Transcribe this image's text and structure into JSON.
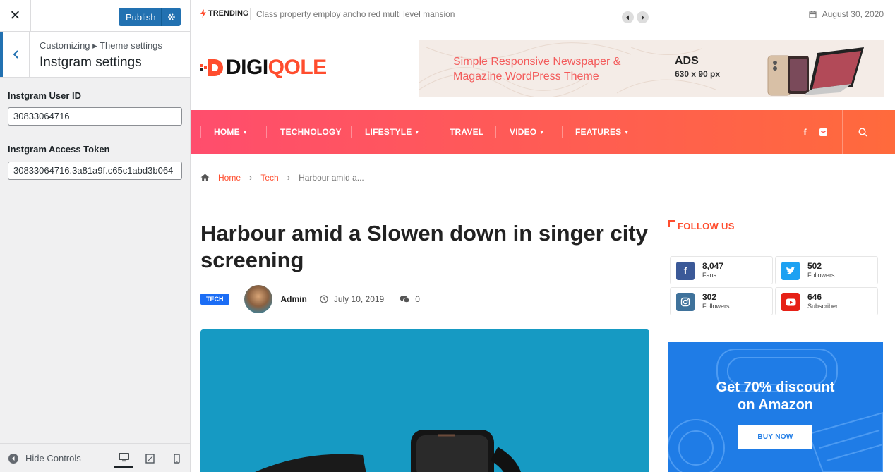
{
  "sidebar": {
    "publish_label": "Publish",
    "breadcrumb": "Customizing ▸ Theme settings",
    "section_title": "Instgram settings",
    "fields": [
      {
        "label": "Instgram User ID",
        "value": "30833064716"
      },
      {
        "label": "Instgram Access Token",
        "value": "30833064716.3a81a9f.c65c1abd3b064"
      }
    ],
    "hide_controls_label": "Hide Controls"
  },
  "site": {
    "trending_label": "TRENDING",
    "trending_headline": "Class property employ ancho red multi level mansion",
    "date": "August 30, 2020",
    "logo_prefix": "DIGI",
    "logo_suffix": "QOLE",
    "ad": {
      "tagline_1": "Simple Responsive Newspaper &",
      "tagline_2": "Magazine WordPress Theme",
      "title": "ADS",
      "size": "630 x 90 px"
    },
    "nav": [
      {
        "label": "HOME",
        "dropdown": true
      },
      {
        "label": "TECHNOLOGY",
        "dropdown": false
      },
      {
        "label": "LIFESTYLE",
        "dropdown": true
      },
      {
        "label": "TRAVEL",
        "dropdown": false
      },
      {
        "label": "VIDEO",
        "dropdown": true
      },
      {
        "label": "FEATURES",
        "dropdown": true
      }
    ],
    "breadcrumb": {
      "home": "Home",
      "category": "Tech",
      "current": "Harbour amid a..."
    },
    "article": {
      "title": "Harbour amid a Slowen down in singer city screening",
      "category": "TECH",
      "author": "Admin",
      "date": "July 10, 2019",
      "comments": "0"
    },
    "follow": {
      "heading": "FOLLOW US",
      "cards": [
        {
          "network": "facebook",
          "count": "8,047",
          "label": "Fans",
          "color": "#3b5998"
        },
        {
          "network": "twitter",
          "count": "502",
          "label": "Followers",
          "color": "#1da1f2"
        },
        {
          "network": "instagram",
          "count": "302",
          "label": "Followers",
          "color": "#3f729b"
        },
        {
          "network": "youtube",
          "count": "646",
          "label": "Subscriber",
          "color": "#e62117"
        }
      ]
    },
    "promo": {
      "line_1": "Get 70% discount",
      "line_2": "on Amazon",
      "button": "BUY NOW"
    }
  },
  "colors": {
    "accent": "#ff4d2e",
    "wp_blue": "#2271b1",
    "badge_blue": "#1b6df5"
  }
}
